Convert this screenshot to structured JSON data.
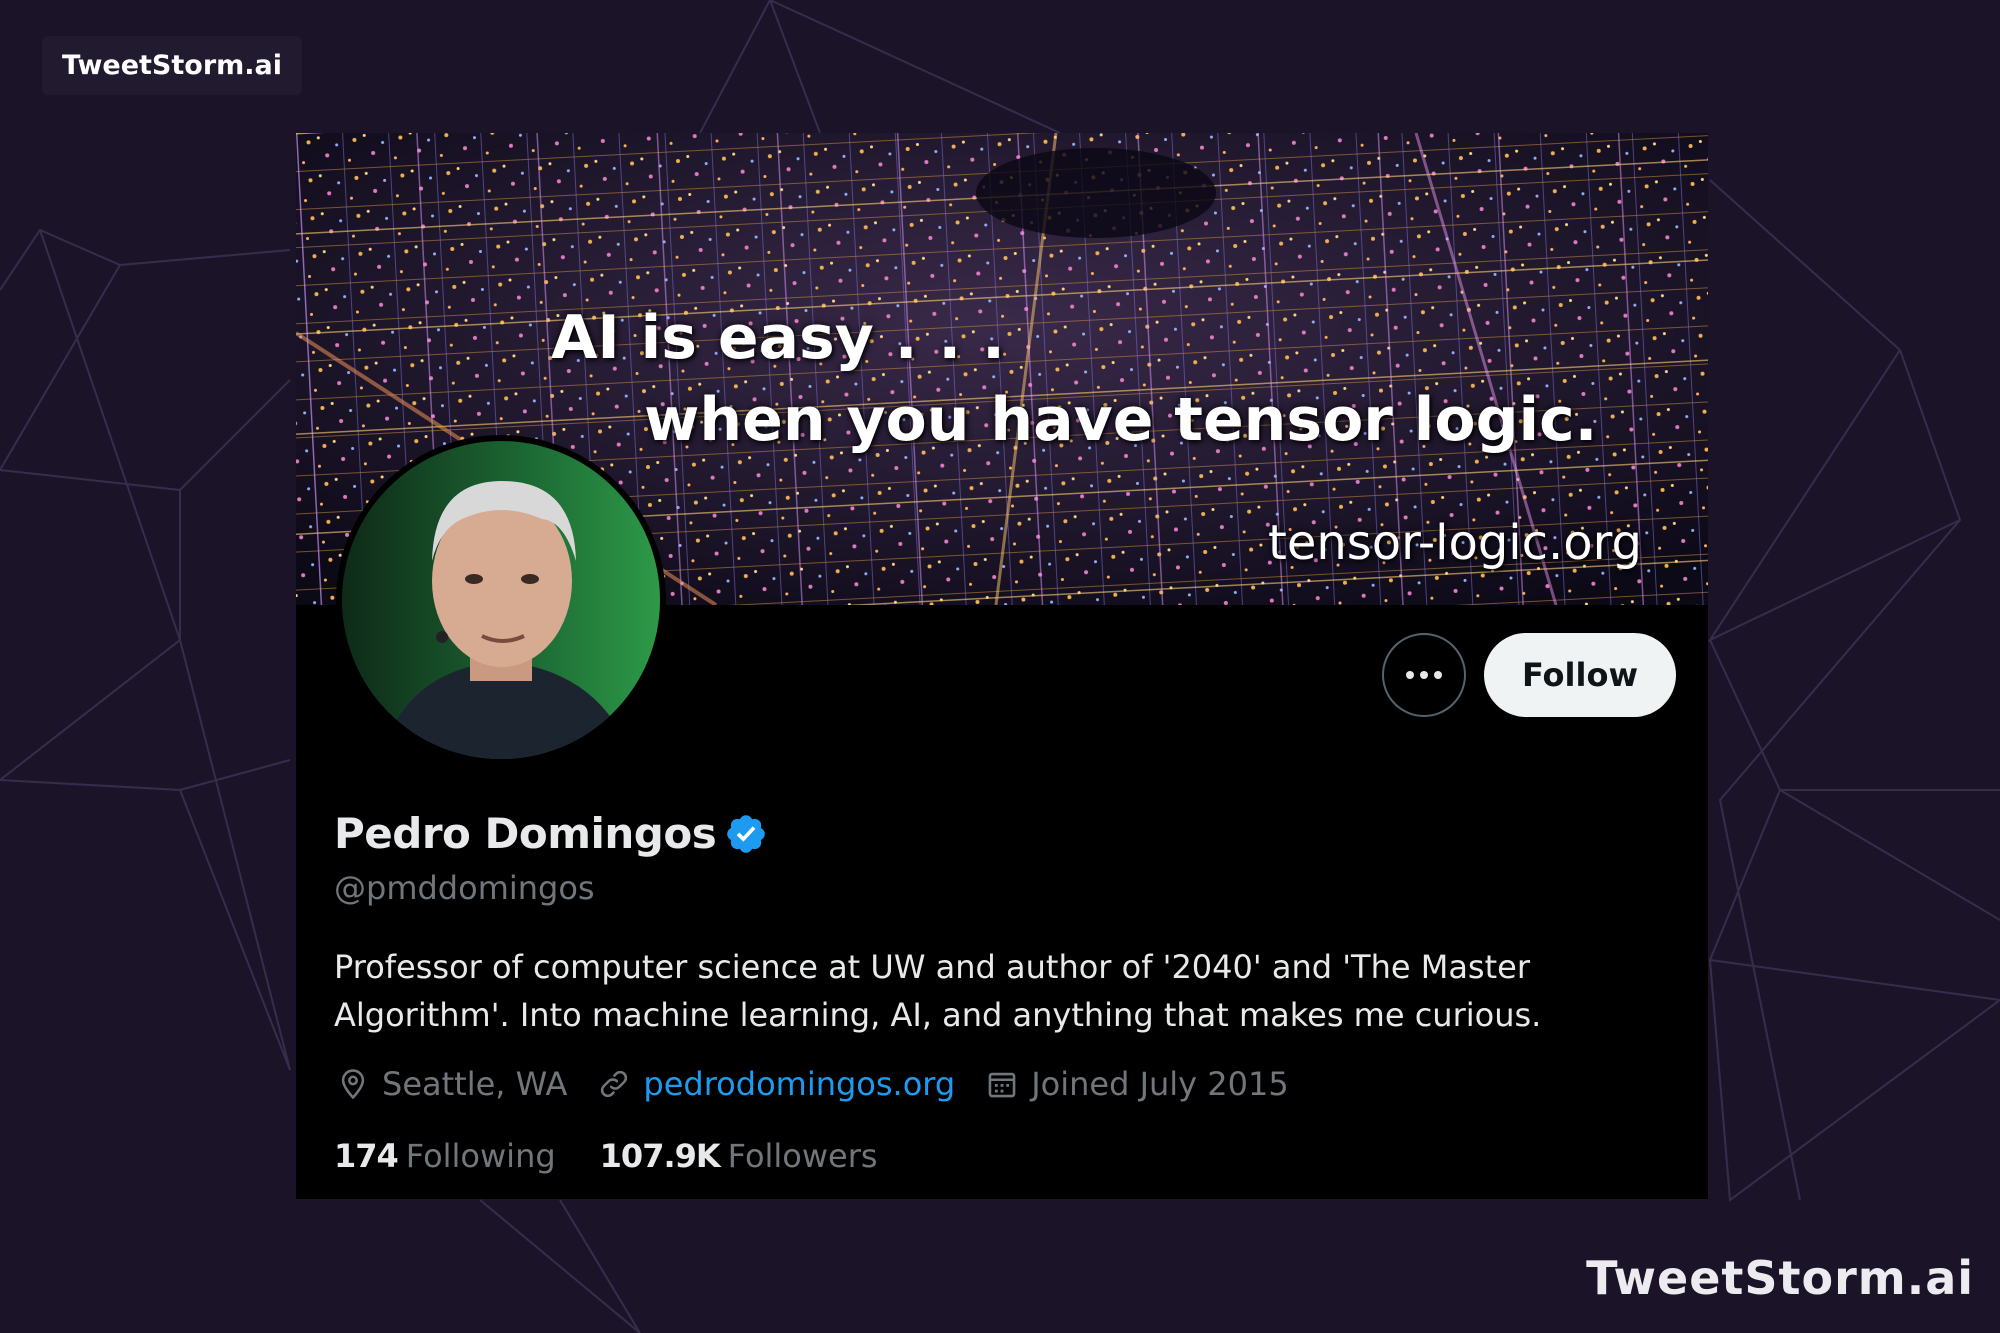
{
  "brand": {
    "top_badge": "TweetStorm.ai",
    "watermark": "TweetStorm.ai"
  },
  "banner": {
    "line1": "AI is easy . . .",
    "line2": "when you have tensor logic.",
    "line3": "tensor-logic.org"
  },
  "profile": {
    "name": "Pedro Domingos",
    "verified": true,
    "handle": "@pmddomingos",
    "bio": "Professor of computer science at UW and author of '2040' and 'The Master Algorithm'. Into machine learning, AI, and anything that makes me curious.",
    "location": "Seattle, WA",
    "website": "pedrodomingos.org",
    "joined": "Joined July 2015",
    "following_count": "174",
    "following_label": "Following",
    "followers_count": "107.9K",
    "followers_label": "Followers"
  },
  "actions": {
    "follow_label": "Follow",
    "more_icon": "more-horizontal-icon"
  },
  "colors": {
    "page_background": "#1b1428",
    "card_background": "#000000",
    "link": "#1d9bf0",
    "verified": "#1d9bf0",
    "follow_button": "#eff3f4",
    "secondary_text": "#71767b"
  }
}
